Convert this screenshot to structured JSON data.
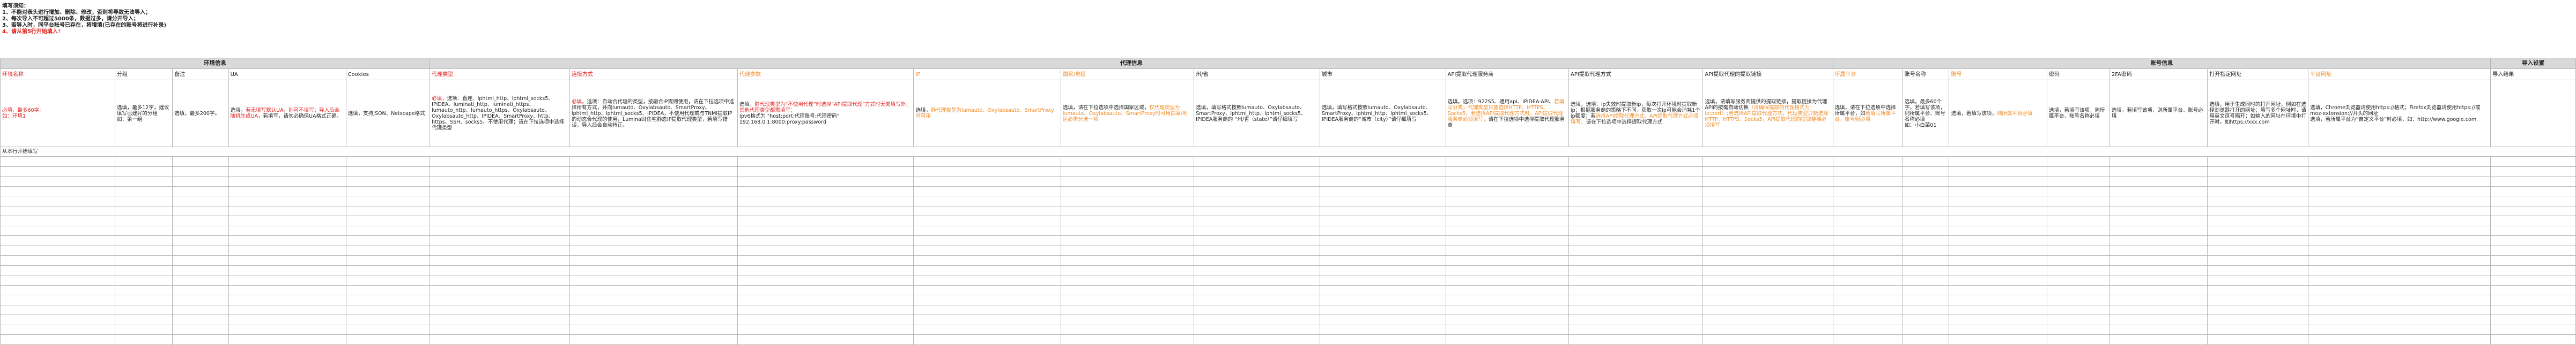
{
  "notes": {
    "title": "填写须知：",
    "line1": "1、不能对表头进行增加、删除、修改，否则将导致无法导入；",
    "line2": "2、每次导入不可超过5000条，数据过多，请分开导入；",
    "line3": "3、若导入时，同平台账号已存在，将增填(已存在的账号将进行补录)",
    "line4": "4、请从第5行开始填入！"
  },
  "groups": {
    "env": "环境信息",
    "proxy": "代理信息",
    "account": "账号信息",
    "import": "导入设置"
  },
  "headers": [
    "环境名称",
    "分组",
    "备注",
    "UA",
    "Cookies",
    "代理类型",
    "连接方式",
    "代理参数",
    "IP",
    "国家/地区",
    "州/省",
    "城市",
    "API提取代理服务商",
    "API提取代理方式",
    "API提取代理的提取链接",
    "所属平台",
    "账号名称",
    "账号",
    "密码",
    "2FA密码",
    "打开指定网址",
    "平台网址",
    "导入结果"
  ],
  "desc": {
    "env_name_a": "必填，最多60字;",
    "env_name_b": "如：环境1",
    "group": "选填，最多12字，建议填写已建好的分组\n如：第一组",
    "remark": "选填，最多200字。",
    "ua_a": "选填，",
    "ua_b": "若无填写默认UA，则可不填写；导入后会随机生成UA",
    "ua_c": "，若填写，请勿必确保UA格式正确。",
    "cookies": "选填，支持JSON、Netscape格式",
    "ptype_a": "必填，",
    "ptype_b": "选项：直连、lphtml_http、lphtml_socks5、IPIDEA、luminati_http、luminati_https、lumauto_http、lumauto_https、Oxylabsauto、Oxylabsauto_http、IPIDEA、SmartProxy、http、https、SSH、socks5、不使用代理；请在下拉选项中选择代理类型",
    "conn_a": "必填，",
    "conn_b": "选项：自动合代理的类型，按融合IP规则使用，请在下拉选项中选择所有方式，并向lumauto、Oxylabsauto、SmartProxy、lphtml_http、lphtml_socks5、IPIDEA，不使用代理或与TNMI提取IP的动态合代理的使用，Luminati[住宅静态IP提取代理类型，若填写错误，导入后会自动转正。",
    "param_a": "选填，",
    "param_b": "静代理类型为“不使用代理”时选择“API提取代理”方式时无需填写外，其他代理类型都需填写；",
    "param_c": "Ipv6格式为 \"host:port:代理账号:代理密码\"",
    "param_d": "192.168.0.1:8000:proxy:password",
    "ip_a": "选填，",
    "ip_b": "静代理类型为lumauto、Oxylabsauto、SmartProxy时可用",
    "country_a": "选填，请在下拉选项中选择国家区域，",
    "country_b": "仅代理类型为lumauto、Oxylabsauto、SmartProxy时可用国家/地区必需分选一项",
    "state_a": "选填，填写格式按照lumauto、Oxylabsauto、SmartProxy、lphtml_http、lphtml_socks5、IPIDEA服务商的 ",
    "state_b": "“州/省（state）”请仔细填写",
    "city": "选填，填写格式按照lumauto、Oxylabsauto、SmartProxy、lphtml_http、lphtml_socks5、IPIDEA服务商的“城市（city）”请仔细填写",
    "api_sp_a": "选填，选项：922S5、通用api、IPIDEA-API、",
    "api_sp_b": "若填写分类，代理类型只能选择HTTP、HTTPS、Socks5，若选择API提取代理方式时，API提取代理服务商必须填写，",
    "api_sp_c": "请在下拉选项中选择提取代理服务商",
    "api_m_a": "选填，选项：ip失效时提取新ip，每次打开环境时提取新ip；根据服务商的策略下不同，获取一次ip可能会消耗1个ip额度；若",
    "api_m_b": "选择API提取代理方式，API提取代理方式必须填写，",
    "api_m_c": "请在下拉选项中选择提取代理方式",
    "api_link_a": "选填，请填写服务商提供的提取链接，提取链接为代理API的按需自动切换",
    "api_link_b": "（请确保提取的代理格式为：ip:port）;若选择API提取代理方式，代理类型只能选择HTTP、HTTPS、Socks5，API提取代理的提取链接必须填写",
    "platform_a": "选填，请在下拉选项中选择所属平台，如",
    "platform_b": "若填写所属平台，账号则必填",
    "acc_name": "选填，最多60个字，若填写该项，则所属平台、账号名称必填\n如：小白菜01",
    "account_a": "选填，若填写该项，",
    "account_b": "则所属平台必填",
    "password": "选填，若填写该项，则所属平台、账号名称必填",
    "twofa": "选填，若填写该项，则所属平台、账号必填",
    "open_url": "选填，用于生成同时的打开网址，例如在选择浏览器打开的网址；填写多个网址时，请用英文逗号隔开；如输入的网址在环境中打开时，如https://xxx.com",
    "open_url_extra": "选填，Chrome浏览器请使用https://格式；Firefox浏览器请使用https://或moz-extension://开头的网址",
    "plat_url_a": "选填，若所属平台为“自定义平台”时必填，",
    "plat_url_b": "如：http://www.google.com"
  },
  "start_row": "从本行开始填写"
}
